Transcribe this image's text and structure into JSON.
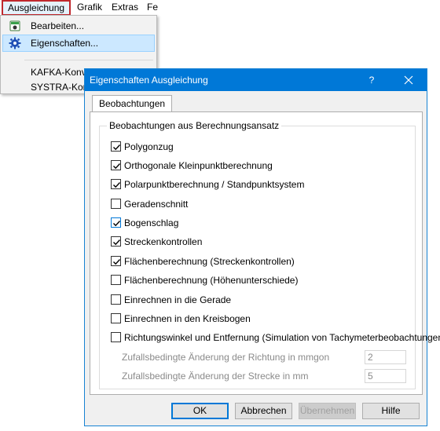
{
  "menubar": {
    "items": [
      {
        "label": "Ausgleichung"
      },
      {
        "label": "Grafik"
      },
      {
        "label": "Extras"
      },
      {
        "label": "Fe"
      }
    ]
  },
  "dropdown": {
    "items": [
      {
        "label": "Bearbeiten...",
        "icon": "edit-doc-icon"
      },
      {
        "label": "Eigenschaften...",
        "icon": "gear-icon"
      },
      {
        "label": "KAFKA-Konverter..."
      },
      {
        "label": "SYSTRA-Konv"
      }
    ]
  },
  "dialog": {
    "title": "Eigenschaften Ausgleichung",
    "help_label": "?",
    "tab": "Beobachtungen",
    "group_title": "Beobachtungen aus Berechnungsansatz",
    "checkboxes": [
      {
        "label": "Polygonzug",
        "checked": true
      },
      {
        "label": "Orthogonale Kleinpunktberechnung",
        "checked": true
      },
      {
        "label": "Polarpunktberechnung / Standpunktsystem",
        "checked": true
      },
      {
        "label": "Geradenschnitt",
        "checked": false
      },
      {
        "label": "Bogenschlag",
        "checked": true
      },
      {
        "label": "Streckenkontrollen",
        "checked": true
      },
      {
        "label": "Flächenberechnung (Streckenkontrollen)",
        "checked": true
      },
      {
        "label": "Flächenberechnung (Höhenunterschiede)",
        "checked": false
      },
      {
        "label": "Einrechnen in die Gerade",
        "checked": false
      },
      {
        "label": "Einrechnen in den Kreisbogen",
        "checked": false
      },
      {
        "label": "Richtungswinkel und Entfernung (Simulation von Tachymeterbeobachtungen)",
        "checked": false
      }
    ],
    "sub_fields": [
      {
        "label": "Zufallsbedingte Änderung der Richtung in mmgon",
        "value": "2"
      },
      {
        "label": "Zufallsbedingte Änderung der Strecke in mm",
        "value": "5"
      }
    ],
    "buttons": {
      "ok": "OK",
      "cancel": "Abbrechen",
      "apply": "Übernehmen",
      "help": "Hilfe"
    }
  },
  "colors": {
    "title_bar": "#0078d7",
    "menu_highlight_border": "#c0282d",
    "dropdown_highlight": "#cce8ff",
    "checkbox_check": "#000000"
  }
}
